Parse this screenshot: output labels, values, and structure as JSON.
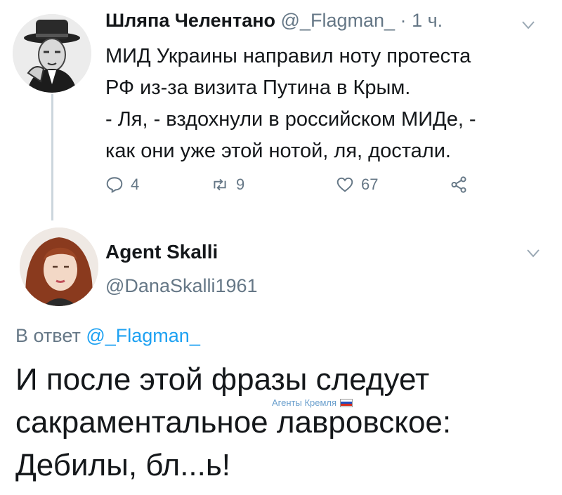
{
  "tweet1": {
    "display_name": "Шляпа Челентано",
    "handle": "@_Flagman_",
    "separator": "·",
    "time": "1 ч.",
    "menu_icon": "chevron-down-icon",
    "lines": [
      "МИД Украины направил ноту протеста",
      "РФ из-за визита Путина в Крым.",
      "- Ля, - вздохнули в российском МИДе, -",
      "как они уже этой нотой, ля, достали."
    ],
    "actions": {
      "reply_count": "4",
      "retweet_count": "9",
      "like_count": "67"
    }
  },
  "tweet2": {
    "display_name": "Agent Skalli",
    "handle": "@DanaSkalli1961",
    "menu_icon": "chevron-down-icon",
    "reply_prefix": "В ответ",
    "reply_handle": "@_Flagman_",
    "lines": [
      "И после этой фразы следует",
      "сакраментальное лавровское:",
      "Дебилы, бл...ь!"
    ]
  },
  "watermark": {
    "text": "Агенты Кремля",
    "flag_colors": [
      "#ffffff",
      "#1f4fbf",
      "#d52b1e"
    ]
  },
  "colors": {
    "text": "#14171a",
    "secondary": "#657786",
    "link": "#1da1f2",
    "thread_line": "#ccd6dd"
  }
}
